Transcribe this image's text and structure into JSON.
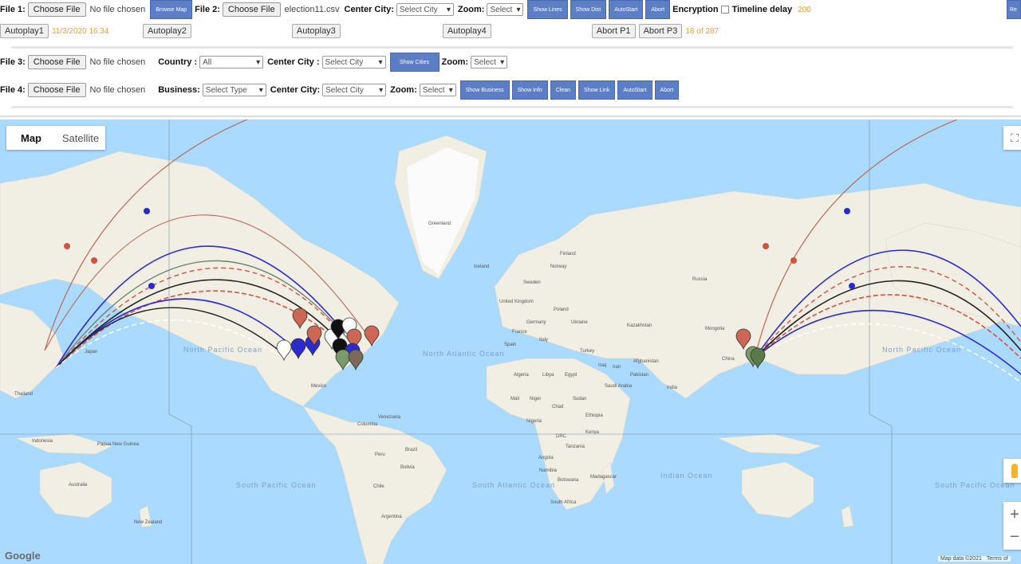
{
  "row1": {
    "file1_label": "File 1:",
    "choose_file": "Choose File",
    "no_file": "No file chosen",
    "browse_map": "Browse Map",
    "file2_label": "File 2:",
    "file2_name": "election11.csv",
    "center_city_label": "Center City:",
    "select_city": "Select City",
    "zoom_label": "Zoom:",
    "select": "Select",
    "show_lines": "Show Lines",
    "show_dist": "Show Dist",
    "autoplay": "AutoStart",
    "abort": "Abort",
    "encryption": "Encryption",
    "timeline_delay": "Timeline delay",
    "delay_value": "200",
    "right_btn": "Re"
  },
  "row2": {
    "autoplay1": "Autoplay1",
    "autoplay1_time": "11/3/2020 16:34",
    "autoplay2": "Autoplay2",
    "autoplay3": "Autoplay3",
    "autoplay4": "Autoplay4",
    "abort_p1": "Abort P1",
    "abort_p3": "Abort P3",
    "progress": "18 of 287"
  },
  "row3": {
    "file3_label": "File 3:",
    "choose_file": "Choose File",
    "no_file": "No file chosen",
    "country_label": "Country :",
    "country_value": "All",
    "center_city_label": "Center City :",
    "select_city": "Select City",
    "show_cities": "Show Cities",
    "zoom_label": "Zoom:",
    "select": "Select"
  },
  "row4": {
    "file4_label": "File 4:",
    "choose_file": "Choose File",
    "no_file": "No file chosen",
    "business_label": "Business:",
    "select_type": "Select Type",
    "center_city_label": "Center City:",
    "select_city": "Select City",
    "zoom_label": "Zoom:",
    "select": "Select",
    "show_business": "Show Business",
    "show_info": "Show Info",
    "clean": "Clean",
    "show_link": "Show Link",
    "autostart": "AutoStart",
    "abort": "Abort"
  },
  "map": {
    "type_map": "Map",
    "type_satellite": "Satellite",
    "google": "Google",
    "footer": "Map data ©2021",
    "terms": "Terms of",
    "oceans": [
      "North Pacific Ocean",
      "North Atlantic Ocean",
      "South Pacific Ocean",
      "South Atlantic Ocean",
      "Indian Ocean",
      "North Pacific Ocean",
      "South Pacific Ocean"
    ],
    "places": [
      "Greenland",
      "Iceland",
      "Finland",
      "Sweden",
      "Norway",
      "United Kingdom",
      "Germany",
      "Poland",
      "Ukraine",
      "France",
      "Italy",
      "Spain",
      "Turkey",
      "Kazakhstan",
      "Russia",
      "Mongolia",
      "China",
      "Iraq",
      "Iran",
      "Afghanistan",
      "Pakistan",
      "India",
      "Algeria",
      "Libya",
      "Egypt",
      "Saudi Arabia",
      "Mali",
      "Niger",
      "Chad",
      "Sudan",
      "Nigeria",
      "Ethiopia",
      "DRC",
      "Kenya",
      "Tanzania",
      "Angola",
      "Namibia",
      "Botswana",
      "South Africa",
      "Madagascar",
      "Mexico",
      "Venezuela",
      "Colombia",
      "Peru",
      "Brazil",
      "Bolivia",
      "Chile",
      "Argentina",
      "Australia",
      "New Zealand",
      "Indonesia",
      "Papua New Guinea",
      "Thailand",
      "Japan"
    ],
    "zoom_in": "+",
    "zoom_out": "−"
  },
  "colors": {
    "blue_button": "#5b7ec4",
    "ocean": "#aadaff",
    "land": "#f0eee4",
    "route_blue": "#1a1acc",
    "route_red": "#cc5544",
    "route_green": "#88bb88"
  }
}
